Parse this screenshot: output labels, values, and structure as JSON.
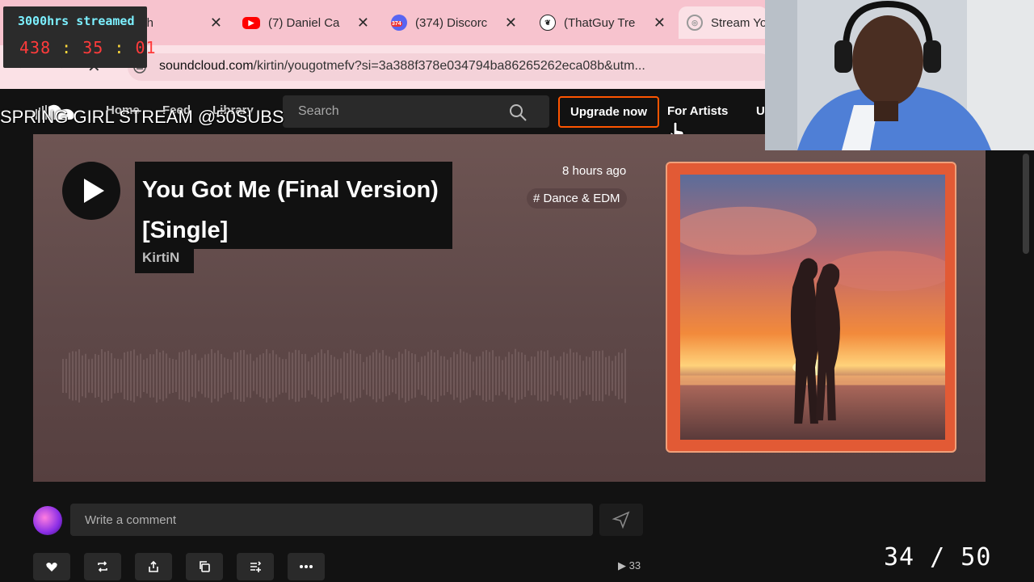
{
  "overlay": {
    "timer_title": "3000hrs streamed",
    "timer_hours": "438",
    "timer_minutes": "35",
    "timer_seconds": "01",
    "timer_sep": ":",
    "stream_title": "SPRING GIRL STREAM @50SUBS",
    "progress": "34 / 50"
  },
  "browser": {
    "tabs": [
      {
        "label": "tch",
        "icon": "twitch-icon"
      },
      {
        "label": "(7) Daniel Ca",
        "icon": "youtube-icon"
      },
      {
        "label": "(374) Discorc",
        "icon": "discord-icon",
        "badge": "374"
      },
      {
        "label": "(ThatGuy Tre",
        "icon": "leaf-icon"
      },
      {
        "label": "Stream Yo",
        "icon": "stream-icon"
      }
    ],
    "url_host": "soundcloud.com",
    "url_path": "/kirtin/yougotmefv?si=3a388f378e034794ba86265262eca08b&utm..."
  },
  "soundcloud": {
    "nav": [
      "Home",
      "Feed",
      "Library"
    ],
    "search_placeholder": "Search",
    "upgrade": "Upgrade now",
    "for_artists": "For Artists",
    "upload_cut": "U",
    "colors": {
      "accent": "#ff5500",
      "art_frame": "#e25a35"
    }
  },
  "track": {
    "title": "You Got Me (Final Version) [Single]",
    "artist": "KirtiN",
    "posted": "8 hours ago",
    "genre": "# Dance & EDM",
    "plays": "33"
  },
  "comment": {
    "placeholder": "Write a comment"
  }
}
